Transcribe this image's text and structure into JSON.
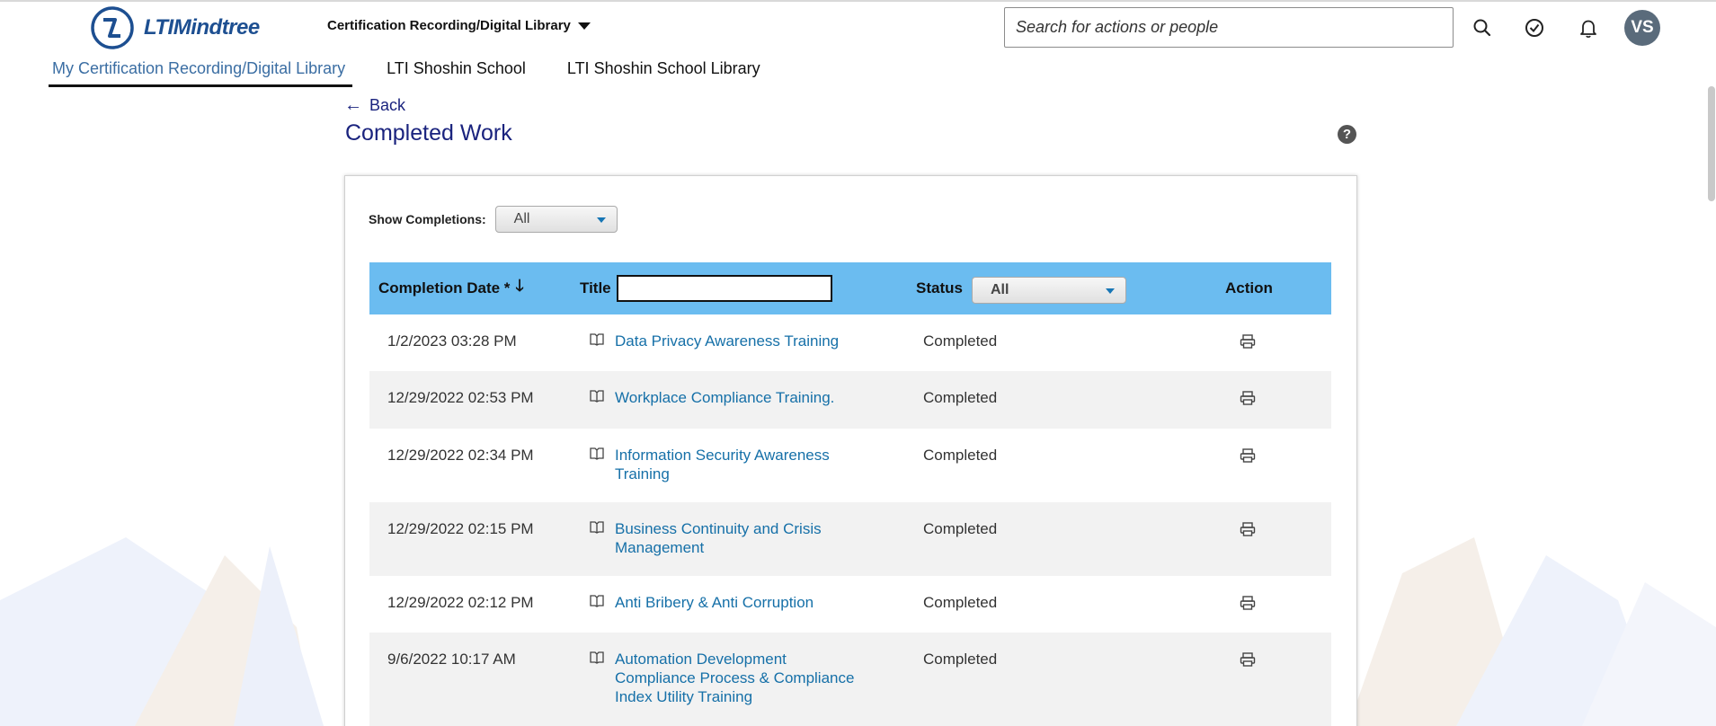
{
  "brand": {
    "name": "LTIMindtree"
  },
  "header": {
    "app_switcher": "Certification Recording/Digital Library",
    "search_placeholder": "Search for actions or people",
    "avatar_initials": "VS"
  },
  "tabs": [
    {
      "label": "My Certification Recording/Digital Library",
      "active": true
    },
    {
      "label": "LTI Shoshin School",
      "active": false
    },
    {
      "label": "LTI Shoshin School Library",
      "active": false
    }
  ],
  "page": {
    "back_label": "Back",
    "title": "Completed Work",
    "help_icon": "?"
  },
  "filters": {
    "show_completions_label": "Show Completions:",
    "show_completions_value": "All"
  },
  "table": {
    "columns": {
      "date": "Completion Date *",
      "title": "Title",
      "status": "Status",
      "status_filter": "All",
      "action": "Action"
    },
    "rows": [
      {
        "date": "1/2/2023 03:28 PM",
        "title": "Data Privacy Awareness Training",
        "status": "Completed"
      },
      {
        "date": "12/29/2022 02:53 PM",
        "title": "Workplace Compliance Training.",
        "status": "Completed"
      },
      {
        "date": "12/29/2022 02:34 PM",
        "title": "Information Security Awareness Training",
        "status": "Completed"
      },
      {
        "date": "12/29/2022 02:15 PM",
        "title": "Business Continuity and Crisis Management",
        "status": "Completed"
      },
      {
        "date": "12/29/2022 02:12 PM",
        "title": "Anti Bribery & Anti Corruption",
        "status": "Completed"
      },
      {
        "date": "9/6/2022 10:17 AM",
        "title": "Automation Development Compliance Process & Compliance Index Utility Training",
        "status": "Completed"
      }
    ]
  },
  "colors": {
    "header_row": "#6bbcf0",
    "link": "#1670a8",
    "title": "#1a237e",
    "brand": "#1d4f91"
  },
  "icons": [
    "ltimindtree-logo",
    "chevron-down-icon",
    "search-icon",
    "check-circle-icon",
    "bell-icon",
    "help-icon",
    "book-icon",
    "print-icon",
    "sort-down-icon"
  ]
}
